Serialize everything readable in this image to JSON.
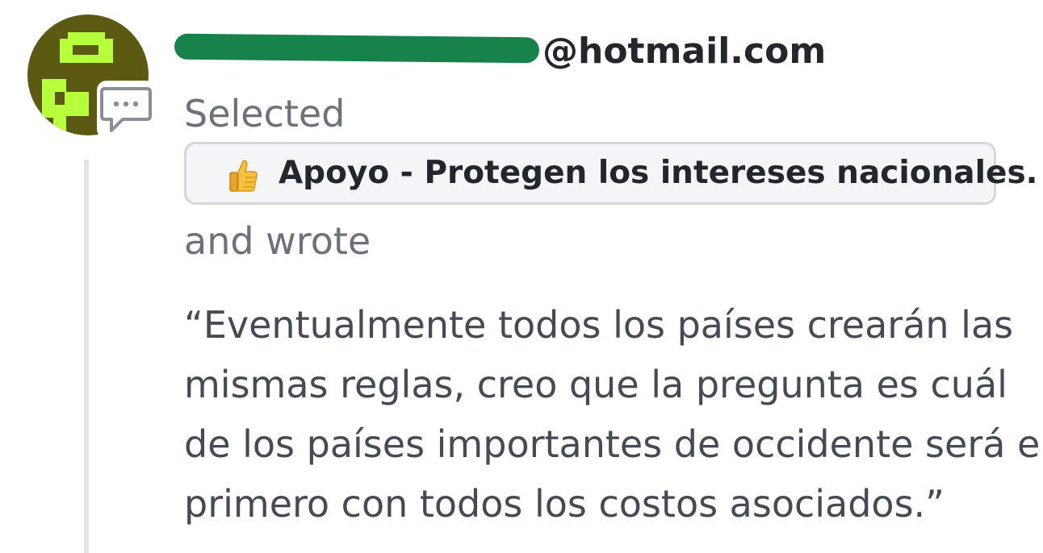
{
  "avatar": {
    "icon": "identicon-avatar",
    "colors": {
      "background": "#5c5a12",
      "pixel": "#b6ff3a"
    }
  },
  "badge": {
    "icon": "comment-bubble-icon"
  },
  "author": {
    "email_visible": "@hotmail.com",
    "redaction_color": "#17824a"
  },
  "selection": {
    "label": "Selected",
    "choice_emoji": "thumbs-up-icon",
    "choice_text": "Apoyo - Protegen los intereses nacionales."
  },
  "wrote_label": "and wrote",
  "quote": {
    "lines": [
      "“Eventualmente todos los países crearán las",
      "mismas reglas, creo que la pregunta es cuál",
      "de los países importantes de occidente será el",
      "primero con todos los costos asociados.”"
    ]
  }
}
